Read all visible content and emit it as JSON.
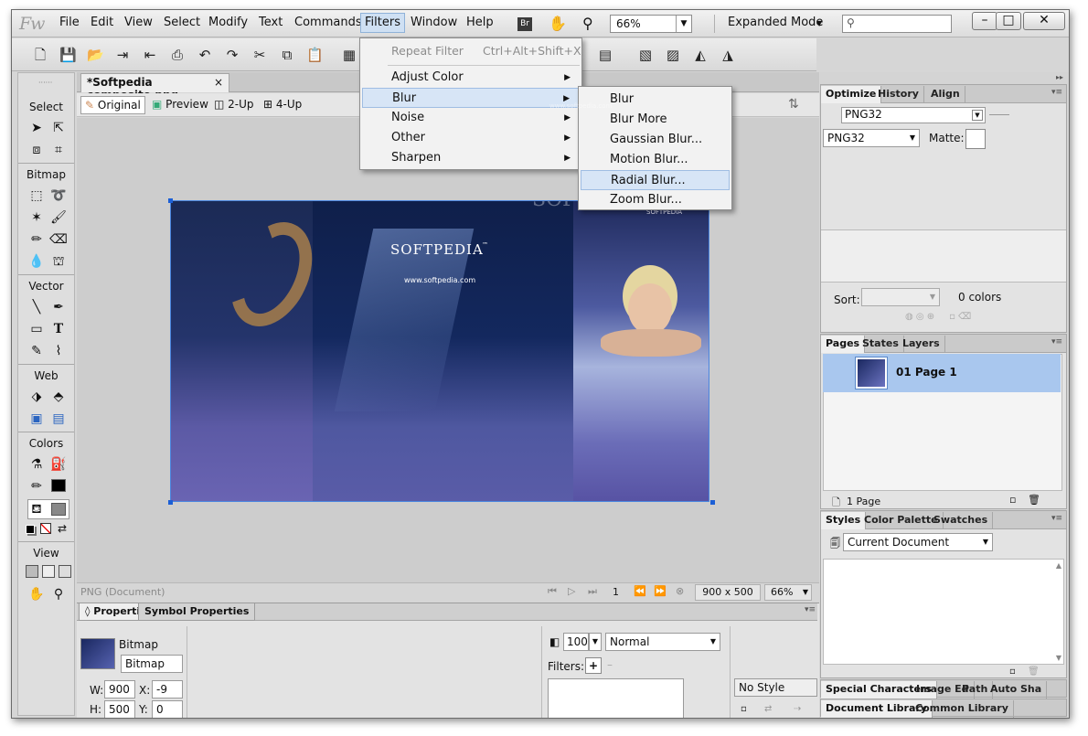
{
  "menubar": {
    "logo": "Fw",
    "items": [
      "File",
      "Edit",
      "View",
      "Select",
      "Modify",
      "Text",
      "Commands",
      "Filters",
      "Window",
      "Help"
    ],
    "bridge": "Br",
    "zoom": "66%",
    "mode": "Expanded Mode",
    "window_controls": {
      "minimize": "–",
      "maximize": "□",
      "close": "✕"
    }
  },
  "tools": {
    "sections": [
      "Select",
      "Bitmap",
      "Vector",
      "Web",
      "Colors",
      "View"
    ]
  },
  "document": {
    "tab": "*Softpedia composite.png",
    "tab_close": "×",
    "views": [
      "Original",
      "Preview",
      "2-Up",
      "4-Up"
    ],
    "image": {
      "title": "SOFTPEDIA",
      "tm": "™",
      "url": "www.softpedia.com",
      "watermark": "SOFTPEDIA",
      "watermark_url": "www.softpedia.com",
      "corner_text": "SOFTPEDIA"
    },
    "status": {
      "label": "PNG (Document)",
      "page": "1",
      "size": "900 x 500",
      "zoom": "66%"
    }
  },
  "filters_menu": {
    "repeat": "Repeat Filter",
    "repeat_shortcut": "Ctrl+Alt+Shift+X",
    "items": [
      "Adjust Color",
      "Blur",
      "Noise",
      "Other",
      "Sharpen"
    ],
    "highlighted": "Blur"
  },
  "blur_submenu": {
    "items": [
      "Blur",
      "Blur More",
      "Gaussian Blur...",
      "Motion Blur...",
      "Radial Blur...",
      "Zoom Blur..."
    ],
    "highlighted": "Radial Blur..."
  },
  "properties": {
    "tabs": [
      "Properties",
      "Symbol Properties"
    ],
    "type": "Bitmap",
    "name": "Bitmap",
    "w_label": "W:",
    "w": "900",
    "x_label": "X:",
    "x": "-9",
    "h_label": "H:",
    "h": "500",
    "y_label": "Y:",
    "y": "0",
    "opacity": "100",
    "blend": "Normal",
    "filters_label": "Filters:",
    "add_filter": "+",
    "style": "No Style"
  },
  "optimize": {
    "tabs": [
      "Optimize",
      "History",
      "Align"
    ],
    "format": "PNG32",
    "format2": "PNG32",
    "matte_label": "Matte:",
    "sort_label": "Sort:",
    "colors": "0 colors"
  },
  "pages": {
    "tabs": [
      "Pages",
      "States",
      "Layers"
    ],
    "page_name": "01  Page 1",
    "footer": "1 Page"
  },
  "styles": {
    "tabs": [
      "Styles",
      "Color Palette",
      "Swatches"
    ],
    "current": "Current Document"
  },
  "bottom_tabs": {
    "row1": [
      "Special Characters",
      "Image Ed",
      "Path",
      "Auto Sha"
    ],
    "row2": [
      "Document Library",
      "Common Library"
    ]
  }
}
